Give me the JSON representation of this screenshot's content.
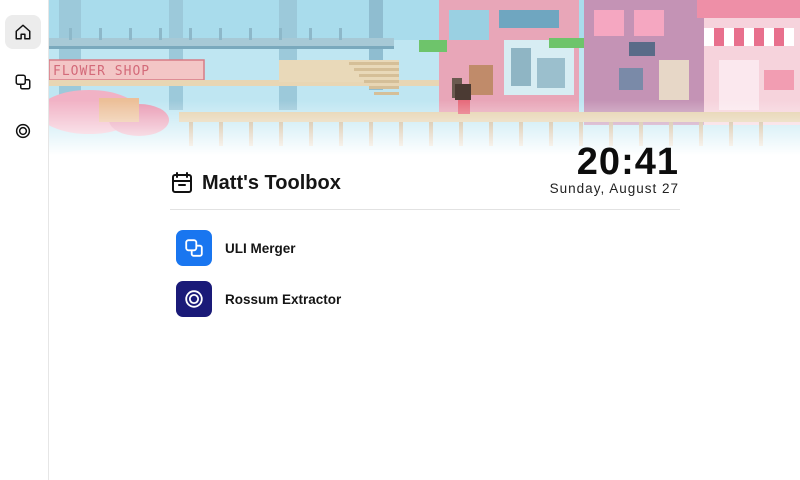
{
  "app": {
    "title": "Matt's Toolbox"
  },
  "sidebar": {
    "items": [
      {
        "icon": "home-icon",
        "active": true
      },
      {
        "icon": "overlap-squares-icon",
        "active": false
      },
      {
        "icon": "target-rings-icon",
        "active": false
      }
    ]
  },
  "banner": {
    "shop_sign": "FLOWER SHOP"
  },
  "clock": {
    "time": "20:41",
    "date": "Sunday, August 27"
  },
  "tools": [
    {
      "label": "ULI Merger",
      "icon": "overlap-squares-icon",
      "color": "#1976f0"
    },
    {
      "label": "Rossum Extractor",
      "icon": "target-rings-icon",
      "color": "#1a1a78"
    }
  ],
  "colors": {
    "accent_blue": "#1976f0",
    "accent_navy": "#1a1a78",
    "sidebar_active": "#ececec"
  }
}
